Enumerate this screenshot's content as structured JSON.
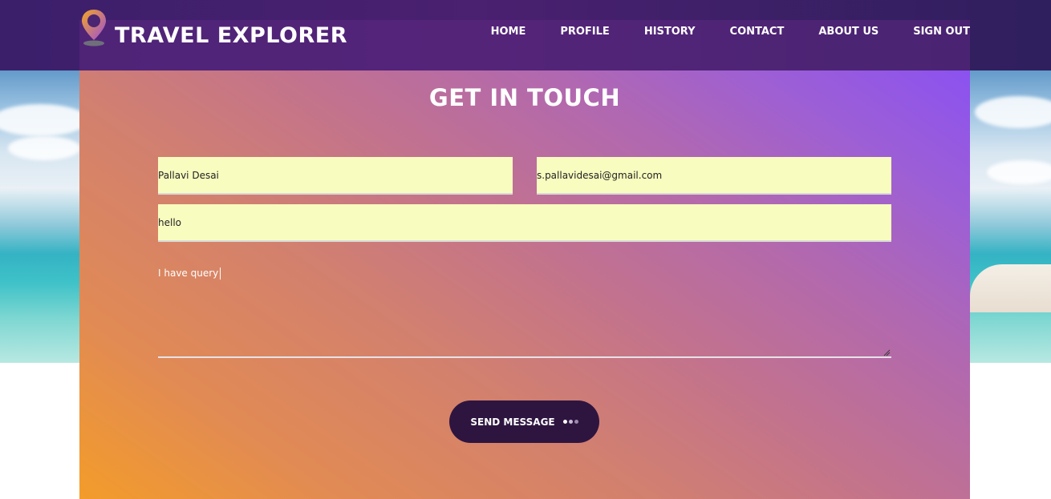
{
  "brand": {
    "name": "TRAVEL EXPLORER",
    "logo_icon": "map-pin-icon"
  },
  "nav": {
    "items": [
      {
        "label": "HOME"
      },
      {
        "label": "PROFILE"
      },
      {
        "label": "HISTORY"
      },
      {
        "label": "CONTACT"
      },
      {
        "label": "ABOUT US"
      },
      {
        "label": "SIGN OUT"
      }
    ]
  },
  "contact": {
    "title": "GET IN TOUCH",
    "name_value": "Pallavi Desai",
    "email_value": "s.pallavidesai@gmail.com",
    "subject_value": "hello",
    "message_value": "I have query",
    "send_label": "SEND MESSAGE"
  },
  "colors": {
    "nav_bg": "#3b1f6b",
    "input_bg": "#f8fcbf",
    "button_bg": "#2e1540",
    "gradient_start": "#f39c2a",
    "gradient_end": "#8b52f0"
  }
}
